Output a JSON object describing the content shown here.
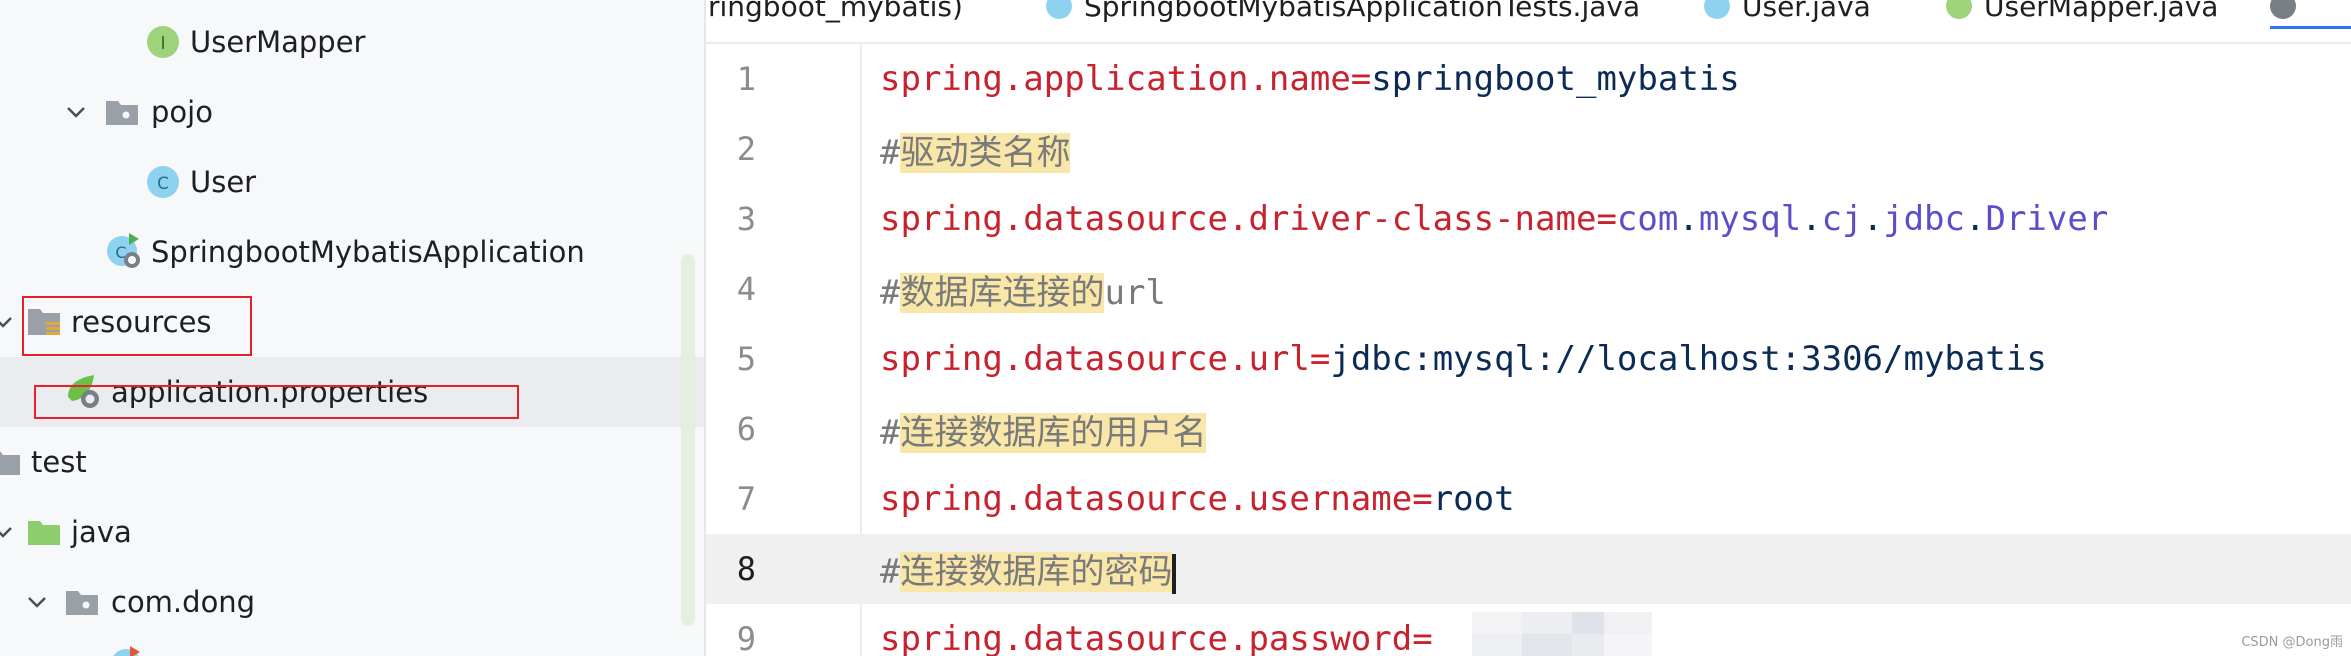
{
  "tree": {
    "items": [
      {
        "label": "UserMapper",
        "icon": "interface-icon"
      },
      {
        "label": "pojo",
        "icon": "package-folder-icon"
      },
      {
        "label": "User",
        "icon": "class-icon"
      },
      {
        "label": "SpringbootMybatisApplication",
        "icon": "spring-boot-app-icon"
      },
      {
        "label": "resources",
        "icon": "resources-folder-icon"
      },
      {
        "label": "application.properties",
        "icon": "spring-properties-icon"
      },
      {
        "label": "test",
        "icon": "folder-icon"
      },
      {
        "label": "java",
        "icon": "test-sources-folder-icon"
      },
      {
        "label": "com.dong",
        "icon": "package-folder-icon"
      }
    ]
  },
  "tabs": [
    {
      "label": "ringboot_mybatis)"
    },
    {
      "label": "SpringbootMybatisApplicationTests.java"
    },
    {
      "label": "User.java"
    },
    {
      "label": "UserMapper.java"
    }
  ],
  "editor": {
    "line_numbers": [
      "1",
      "2",
      "3",
      "4",
      "5",
      "6",
      "7",
      "8",
      "9"
    ],
    "current_line": "8",
    "lines": {
      "l1_key": "spring.application.name=",
      "l1_val": "springboot_mybatis",
      "l2_hash": "#",
      "l2_text": "驱动类名称",
      "l3_key": "spring.datasource.driver-class-name=",
      "l3_p1": "com",
      "l3_p2": "mysql",
      "l3_p3": "cj",
      "l3_p4": "jdbc",
      "l3_p5": "Driver",
      "l4_hash": "#",
      "l4_text": "数据库连接的",
      "l4_tail": "url",
      "l5_key": "spring.datasource.url=",
      "l5_val": "jdbc:mysql://localhost:3306/mybatis",
      "l6_hash": "#",
      "l6_text": "连接数据库的用户名",
      "l7_key": "spring.datasource.username=",
      "l7_val": "root",
      "l8_hash": "#",
      "l8_text": "连接数据库的密码",
      "l9_key": "spring.datasource.password="
    }
  },
  "watermark": "CSDN @Dong雨",
  "colors": {
    "key": "#c7222d",
    "value": "#0b2a56",
    "package": "#5b4ec9",
    "comment_highlight": "#f8e7a8",
    "annotation_box": "#e8202a"
  }
}
